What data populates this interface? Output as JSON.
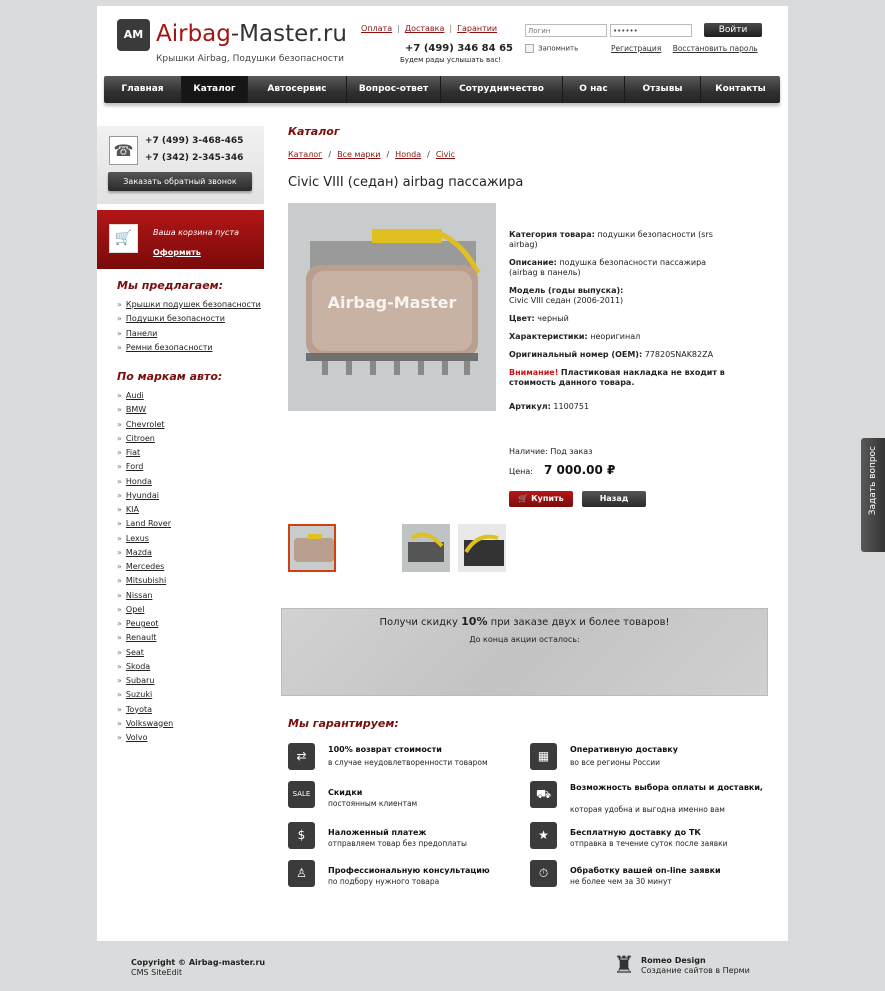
{
  "header": {
    "logo_badge": "AM",
    "logo_red": "Airbag",
    "logo_dark": "-Master.ru",
    "tagline": "Крышки Airbag, Подушки безопасности",
    "links": [
      "Оплата",
      "Доставка",
      "Гарантии"
    ],
    "phone": "+7 (499) 346 84 65",
    "phone_note": "Будем рады услышать вас!",
    "login_placeholder": "Логин",
    "password_value": "••••••",
    "login_button": "Войти",
    "remember": "Запомнить",
    "register": "Регистрация",
    "restore": "Восстановить пароль"
  },
  "nav": [
    "Главная",
    "Каталог",
    "Автосервис",
    "Вопрос-ответ",
    "Сотрудничество",
    "О нас",
    "Отзывы",
    "Контакты"
  ],
  "sidebar": {
    "phone1": "+7 (499) 3-468-465",
    "phone2": "+7 (342) 2-345-346",
    "callback_button": "Заказать обратный звонок",
    "cart_empty": "Ваша корзина пуста",
    "cart_checkout": "Оформить",
    "offer_title": "Мы предлагаем:",
    "offers": [
      "Крышки подушек безопасности",
      "Подушки безопасности",
      "Панели",
      "Ремни безопасности"
    ],
    "brands_title": "По маркам авто:",
    "brands": [
      "Audi",
      "BMW",
      "Chevrolet",
      "Citroen",
      "Fiat",
      "Ford",
      "Honda",
      "Hyundai",
      "KIA",
      "Land Rover",
      "Lexus",
      "Mazda",
      "Mercedes",
      "Mitsubishi",
      "Nissan",
      "Opel",
      "Peugeot",
      "Renault",
      "Seat",
      "Skoda",
      "Subaru",
      "Suzuki",
      "Toyota",
      "Volkswagen",
      "Volvo"
    ]
  },
  "main": {
    "section_title": "Каталог",
    "breadcrumbs": [
      "Каталог",
      "Все марки",
      "Honda",
      "Civic"
    ],
    "product_title": "Civic VIII (седан) airbag пассажира",
    "watermark": "Airbag-Master",
    "props": {
      "category_label": "Категория товара:",
      "category_value": "подушки безопасности (srs airbag)",
      "desc_label": "Описание:",
      "desc_value": "подушка безопасности пассажира (airbag в панель)",
      "model_label": "Модель (годы выпуска):",
      "model_value": "Civic VIII седан (2006-2011)",
      "color_label": "Цвет:",
      "color_value": "черный",
      "char_label": "Характеристики:",
      "char_value": "неоригинал",
      "oem_label": "Оригинальный номер (OEM):",
      "oem_value": "77820SNAK82ZA",
      "warn_label": "Внимание!",
      "warn_value": "Пластиковая накладка не входит в стоимость данного товара.",
      "article_label": "Артикул:",
      "article_value": "1100751"
    },
    "availability_label": "Наличие:",
    "availability_value": "Под заказ",
    "price_label": "Цена:",
    "price": "7 000.00 ₽",
    "buy_button": "Купить",
    "back_button": "Назад",
    "promo_pre": "Получи скидку ",
    "promo_percent": "10%",
    "promo_post": " при заказе двух и более товаров!",
    "promo_sub": "До конца акции осталось:",
    "guarantee_title": "Мы гарантируем:",
    "guarantees": [
      {
        "title": "100% возврат стоимости",
        "text": "в случае неудовлетворенности товаром"
      },
      {
        "title": "Оперативную доставку",
        "text": "во все регионы России"
      },
      {
        "title": "Скидки",
        "text": "постоянным клиентам"
      },
      {
        "title": "Возможность выбора оплаты и доставки,",
        "text": "которая удобна и выгодна именно вам"
      },
      {
        "title": "Наложенный платеж",
        "text": "отправляем товар без предоплаты"
      },
      {
        "title": "Бесплатную доставку до ТК",
        "text": "отправка в течение суток после заявки"
      },
      {
        "title": "Профессиональную консультацию",
        "text": "по подбору нужного товара"
      },
      {
        "title": "Обработку вашей on-line заявки",
        "text": "не более чем за 30 минут"
      }
    ],
    "sale_icon_text": "SALE"
  },
  "footer": {
    "copyright": "Copyright © Airbag-master.ru",
    "cms": "CMS SiteEdit",
    "designer": "Romeo Design",
    "designer_sub": "Создание сайтов в Перми"
  },
  "ask_button": "Задать вопрос",
  "colors": {
    "accent": "#7a0d0d",
    "brand_red": "#a31414",
    "nav_bg": "#2f2f2f"
  }
}
